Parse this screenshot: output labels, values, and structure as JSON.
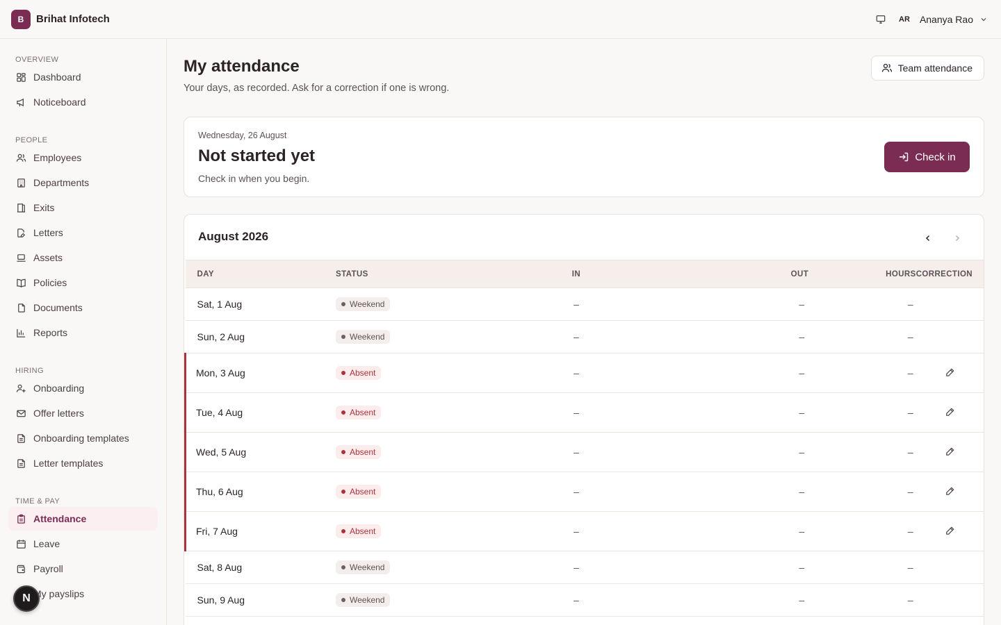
{
  "topbar": {
    "logo_letter": "B",
    "brand": "Brihat Infotech",
    "user_initials": "AR",
    "user_name": "Ananya Rao"
  },
  "sidebar": {
    "sections": [
      {
        "label": "OVERVIEW",
        "items": [
          {
            "label": "Dashboard",
            "icon": "dashboard-icon"
          },
          {
            "label": "Noticeboard",
            "icon": "megaphone-icon"
          }
        ]
      },
      {
        "label": "PEOPLE",
        "items": [
          {
            "label": "Employees",
            "icon": "users-icon"
          },
          {
            "label": "Departments",
            "icon": "building-icon"
          },
          {
            "label": "Exits",
            "icon": "door-icon"
          },
          {
            "label": "Letters",
            "icon": "file-edit-icon"
          },
          {
            "label": "Assets",
            "icon": "laptop-icon"
          },
          {
            "label": "Policies",
            "icon": "book-icon"
          },
          {
            "label": "Documents",
            "icon": "files-icon"
          },
          {
            "label": "Reports",
            "icon": "bar-chart-icon"
          }
        ]
      },
      {
        "label": "HIRING",
        "items": [
          {
            "label": "Onboarding",
            "icon": "user-plus-icon"
          },
          {
            "label": "Offer letters",
            "icon": "mail-icon"
          },
          {
            "label": "Onboarding templates",
            "icon": "file-text-icon"
          },
          {
            "label": "Letter templates",
            "icon": "file-text-icon"
          }
        ]
      },
      {
        "label": "TIME & PAY",
        "items": [
          {
            "label": "Attendance",
            "icon": "clipboard-icon",
            "active": true
          },
          {
            "label": "Leave",
            "icon": "calendar-icon"
          },
          {
            "label": "Payroll",
            "icon": "wallet-icon"
          },
          {
            "label": "My payslips",
            "icon": "receipt-icon"
          }
        ]
      }
    ],
    "fab_letter": "N"
  },
  "page": {
    "title": "My attendance",
    "subtitle": "Your days, as recorded. Ask for a correction if one is wrong.",
    "team_button": "Team attendance"
  },
  "today": {
    "date": "Wednesday, 26 August",
    "status": "Not started yet",
    "hint": "Check in when you begin.",
    "checkin_label": "Check in"
  },
  "month": {
    "title": "August 2026",
    "columns": {
      "day": "DAY",
      "status": "STATUS",
      "in": "IN",
      "out": "OUT",
      "hours": "HOURS",
      "correction": "CORRECTION"
    },
    "rows": [
      {
        "day": "Sat, 1 Aug",
        "status": "Weekend",
        "in": "–",
        "out": "–",
        "hours": "–",
        "correction": false
      },
      {
        "day": "Sun, 2 Aug",
        "status": "Weekend",
        "in": "–",
        "out": "–",
        "hours": "–",
        "correction": false
      },
      {
        "day": "Mon, 3 Aug",
        "status": "Absent",
        "in": "–",
        "out": "–",
        "hours": "–",
        "correction": true
      },
      {
        "day": "Tue, 4 Aug",
        "status": "Absent",
        "in": "–",
        "out": "–",
        "hours": "–",
        "correction": true
      },
      {
        "day": "Wed, 5 Aug",
        "status": "Absent",
        "in": "–",
        "out": "–",
        "hours": "–",
        "correction": true
      },
      {
        "day": "Thu, 6 Aug",
        "status": "Absent",
        "in": "–",
        "out": "–",
        "hours": "–",
        "correction": true
      },
      {
        "day": "Fri, 7 Aug",
        "status": "Absent",
        "in": "–",
        "out": "–",
        "hours": "–",
        "correction": true
      },
      {
        "day": "Sat, 8 Aug",
        "status": "Weekend",
        "in": "–",
        "out": "–",
        "hours": "–",
        "correction": false
      },
      {
        "day": "Sun, 9 Aug",
        "status": "Weekend",
        "in": "–",
        "out": "–",
        "hours": "–",
        "correction": false
      }
    ]
  },
  "colors": {
    "brand": "#7a2c52",
    "absent": "#a8333f",
    "active_bg": "#fbeff2"
  }
}
